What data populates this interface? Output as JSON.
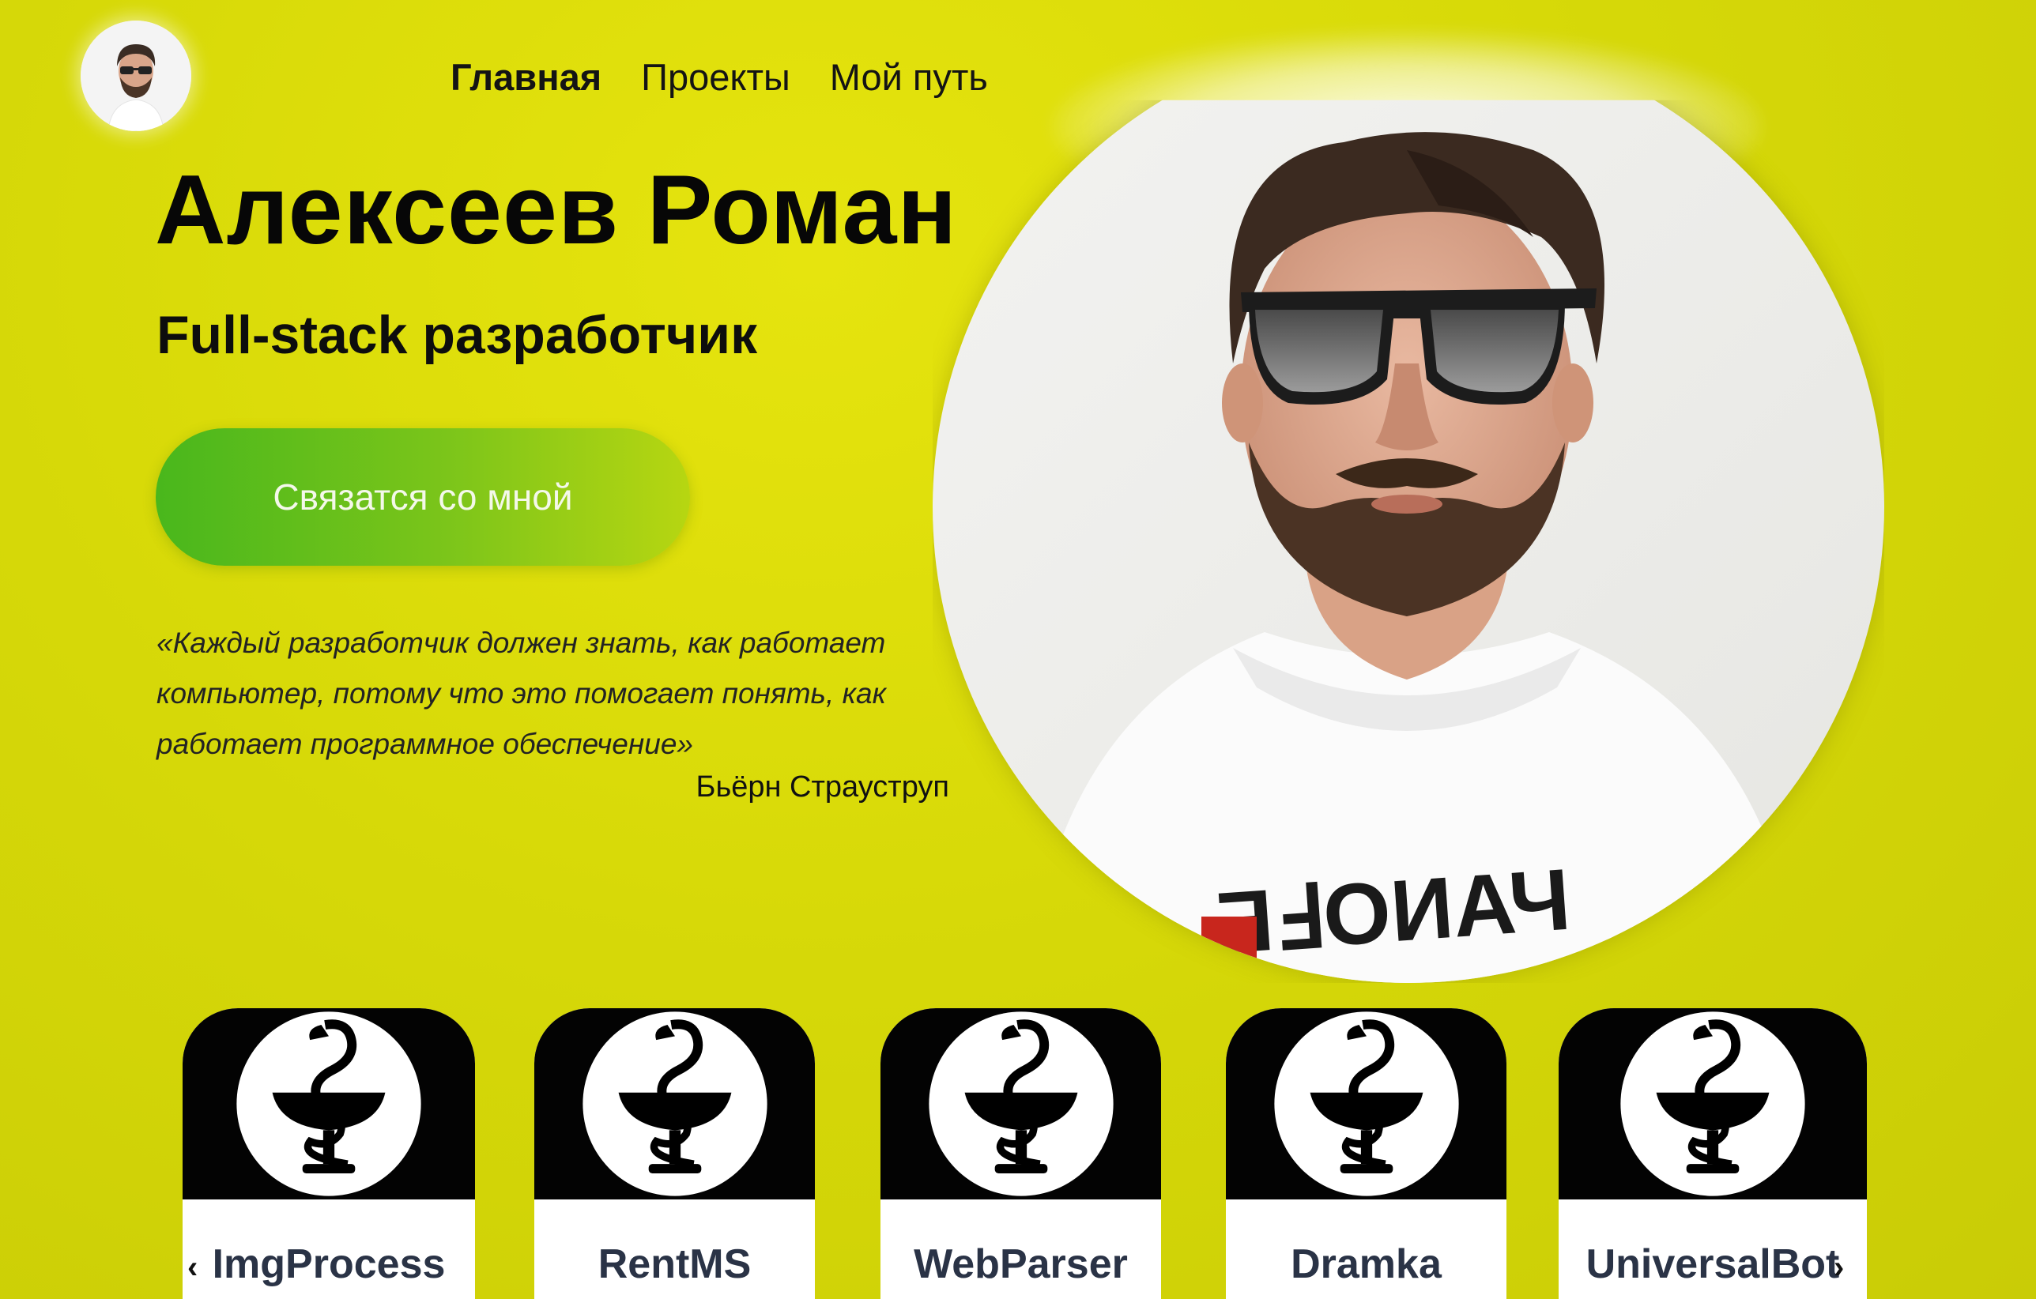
{
  "nav": {
    "items": [
      {
        "label": "Главная",
        "active": true
      },
      {
        "label": "Проекты",
        "active": false
      },
      {
        "label": "Мой путь",
        "active": false
      }
    ]
  },
  "hero": {
    "name": "Алексеев Роман",
    "role": "Full-stack разработчик",
    "contact_button": "Связатся со мной",
    "quote": "«Каждый разработчик должен знать, как работает компьютер, потому что это помогает понять, как работает программное обеспечение»",
    "quote_author": "Бьёрн Страуструп"
  },
  "projects": {
    "prev_arrow": "‹",
    "next_arrow": "›",
    "items": [
      {
        "title": "ImgProcess",
        "icon": "caduceus-bowl-icon"
      },
      {
        "title": "RentMS",
        "icon": "caduceus-bowl-icon"
      },
      {
        "title": "WebParser",
        "icon": "caduceus-bowl-icon"
      },
      {
        "title": "Dramka",
        "icon": "caduceus-bowl-icon"
      },
      {
        "title": "UniversalBot",
        "icon": "caduceus-bowl-icon"
      }
    ]
  },
  "colors": {
    "background": "#d7d908",
    "button_start": "#49b71c",
    "button_end": "#b7d611",
    "card_title": "#2a3346"
  }
}
